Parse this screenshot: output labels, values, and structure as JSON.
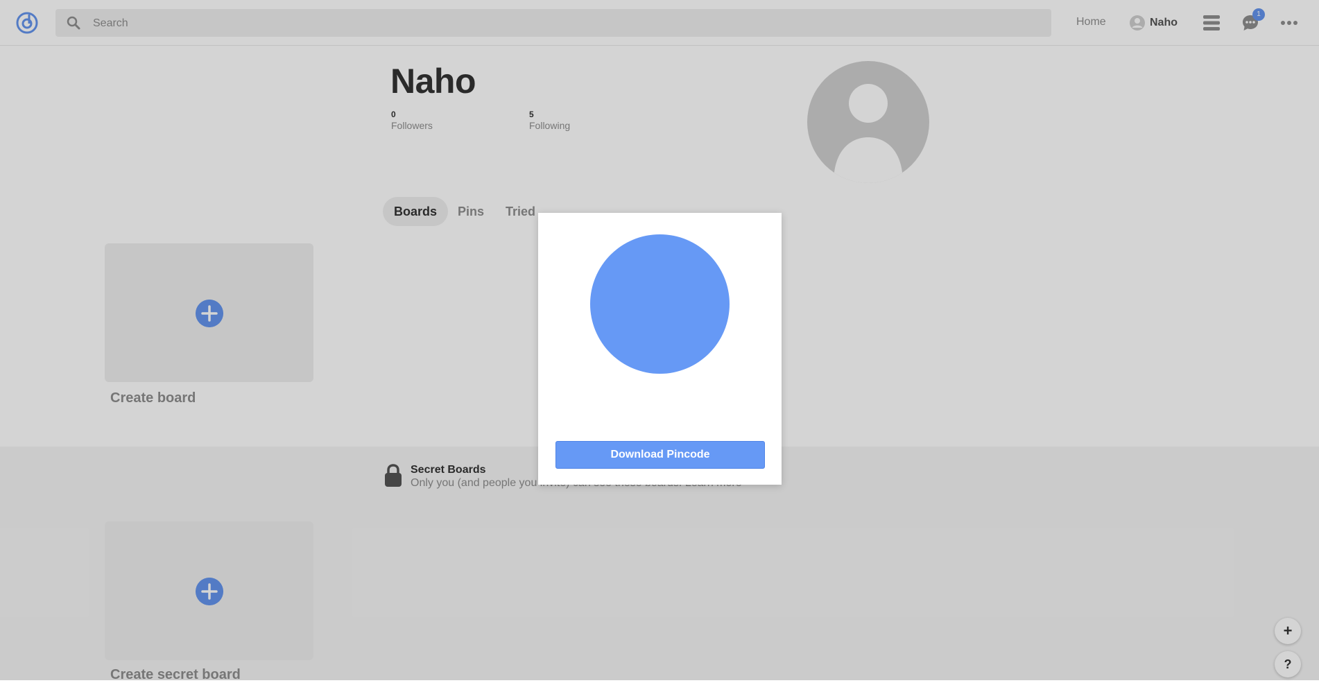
{
  "header": {
    "logo_icon": "logo-icon",
    "search_placeholder": "Search",
    "search_value": "",
    "home_label": "Home",
    "user_label": "Naho",
    "chat_badge": "1",
    "accent_color": "#6495ed"
  },
  "profile": {
    "name": "Naho",
    "followers_count": "0",
    "followers_label": "Followers",
    "following_count": "5",
    "following_label": "Following"
  },
  "tabs": [
    {
      "label": "Boards",
      "active": true
    },
    {
      "label": "Pins",
      "active": false
    },
    {
      "label": "Tried",
      "active": false
    }
  ],
  "boards": {
    "create_label": "Create board",
    "create_secret_label": "Create secret board"
  },
  "secret": {
    "title": "Secret Boards",
    "description": "Only you (and people you invite) can see these boards.",
    "learn_more": "Learn more"
  },
  "floating": {
    "add": "+",
    "help": "?"
  },
  "modal": {
    "button_label": "Download Pincode",
    "pincode_color": "#6699f5"
  }
}
